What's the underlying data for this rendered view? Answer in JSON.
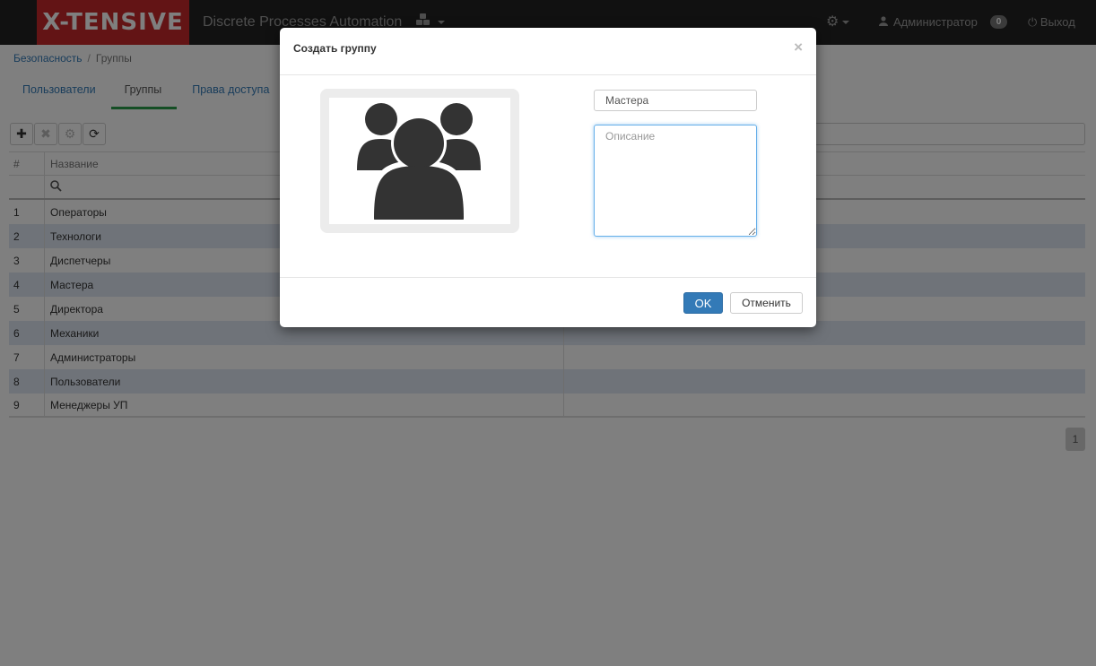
{
  "navbar": {
    "brand": "X-TENSIVE",
    "app_title": "Discrete Processes Automation",
    "apps_icon": "cubes-icon",
    "settings_icon": "gear-icon",
    "user_name": "Администратор",
    "notifications": "0",
    "logout_label": "Выход"
  },
  "breadcrumb": {
    "root": "Безопасность",
    "current": "Группы"
  },
  "tabs": [
    {
      "label": "Пользователи",
      "active": false
    },
    {
      "label": "Группы",
      "active": true
    },
    {
      "label": "Права доступа",
      "active": false
    }
  ],
  "grid": {
    "headers": {
      "num": "#",
      "name": "Название"
    },
    "rows": [
      {
        "num": "1",
        "name": "Операторы"
      },
      {
        "num": "2",
        "name": "Технологи"
      },
      {
        "num": "3",
        "name": "Диспетчеры"
      },
      {
        "num": "4",
        "name": "Мастера"
      },
      {
        "num": "5",
        "name": "Директора"
      },
      {
        "num": "6",
        "name": "Механики"
      },
      {
        "num": "7",
        "name": "Администраторы"
      },
      {
        "num": "8",
        "name": "Пользователи"
      },
      {
        "num": "9",
        "name": "Менеджеры УП"
      }
    ],
    "page": "1"
  },
  "modal": {
    "title": "Создать группу",
    "close": "×",
    "name_value": "Мастера",
    "description_placeholder": "Описание",
    "ok_label": "OK",
    "cancel_label": "Отменить"
  },
  "colors": {
    "brand": "#c7282a",
    "navbar": "#222222",
    "primary": "#337ab7",
    "active_tab": "#2a9d4a",
    "row_alt": "#dfe6f2"
  }
}
